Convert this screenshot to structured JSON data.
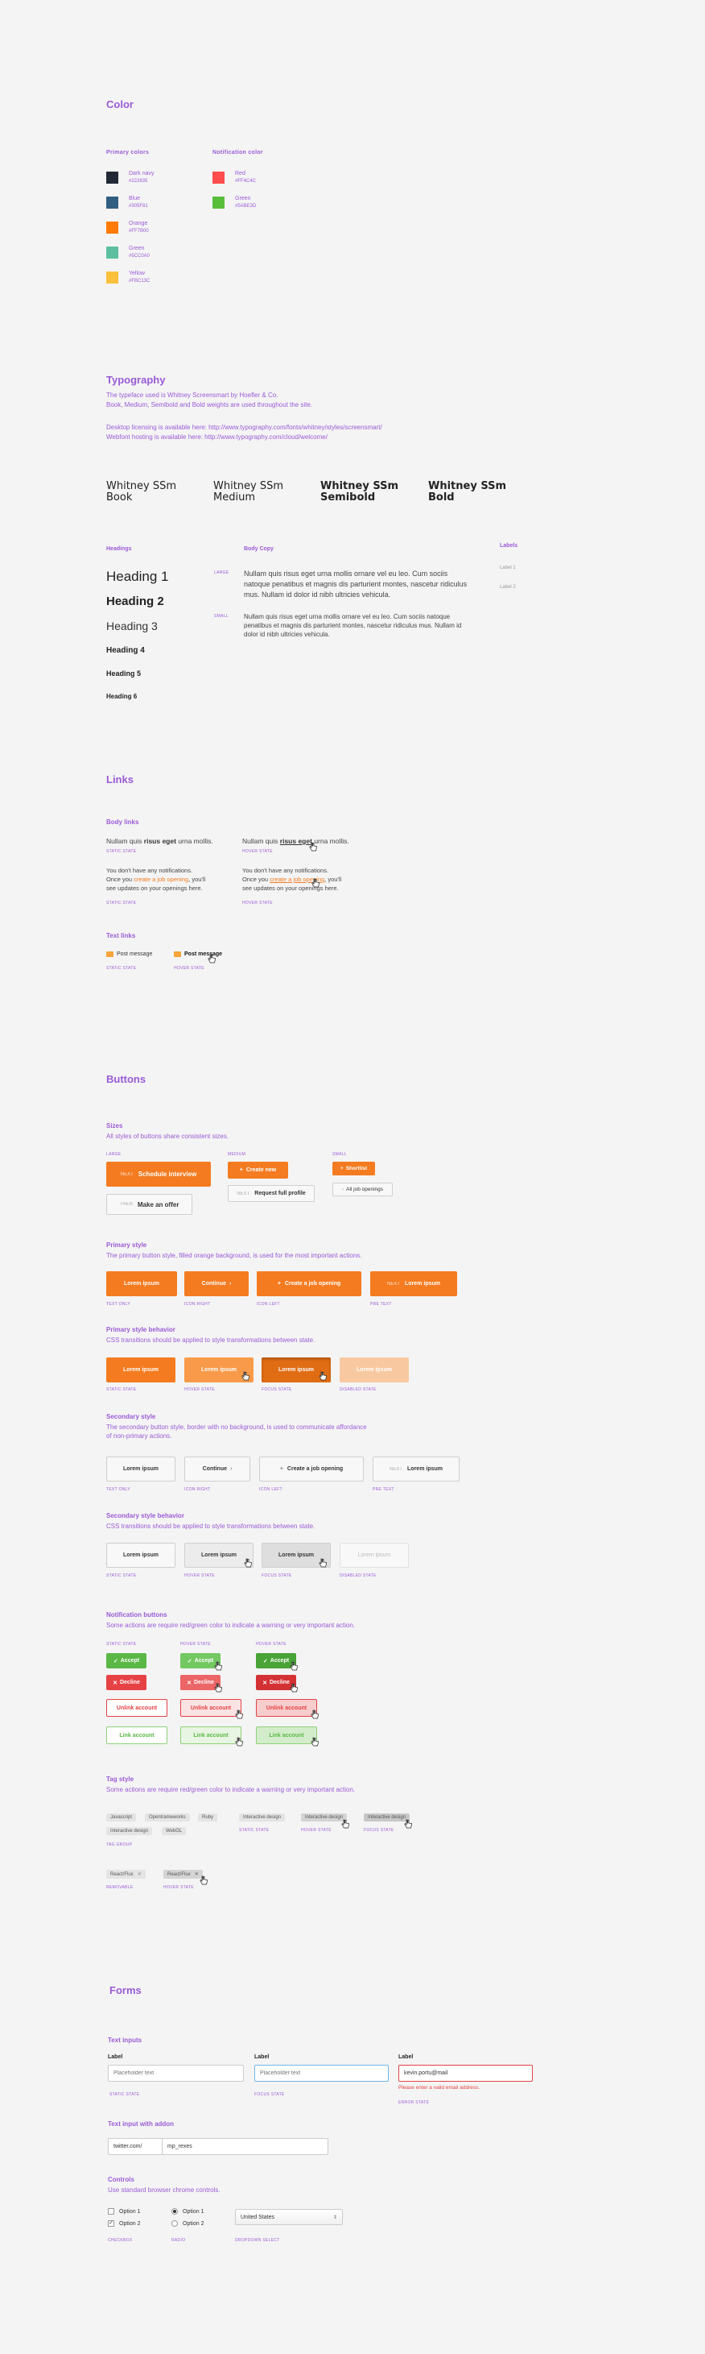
{
  "color": {
    "title": "Color",
    "primary_title": "Primary colors",
    "primary": [
      {
        "name": "Dark navy",
        "hex": "#222835",
        "color": "#222835"
      },
      {
        "name": "Blue",
        "hex": "#305F81",
        "color": "#305F81"
      },
      {
        "name": "Orange",
        "hex": "#FF7B00",
        "color": "#FF7B00"
      },
      {
        "name": "Green",
        "hex": "#5CC0A0",
        "color": "#5CC0A0"
      },
      {
        "name": "Yellow",
        "hex": "#FBC13C",
        "color": "#FBC13C"
      }
    ],
    "notif_title": "Notification color",
    "notif": [
      {
        "name": "Red",
        "hex": "#FF4C4C",
        "color": "#FF4C4C"
      },
      {
        "name": "Green",
        "hex": "#5ABE3D",
        "color": "#5ABE3D"
      }
    ]
  },
  "typography": {
    "title": "Typography",
    "line1": "The typeface used is Whitney Screensmart by Hoefler & Co.",
    "line2": "Book, Medium, Semibold and Bold weights are used throughout the site.",
    "line3": "Desktop licensing is available here: http://www.typography.com/fonts/whitney/styles/screensmart/",
    "line4": "Webfont hosting is available here: http://www.typography.com/cloud/welcome/",
    "weights": [
      "Whitney SSm Book",
      "Whitney SSm Medium",
      "Whitney SSm Semibold",
      "Whitney SSm Bold"
    ],
    "headings_label": "Headings",
    "headings": [
      "Heading 1",
      "Heading 2",
      "Heading 3",
      "Heading 4",
      "Heading 5",
      "Heading 6"
    ],
    "body_label": "Body Copy",
    "large_label": "LARGE",
    "small_label": "SMALL",
    "body_large": "Nullam quis risus eget urna mollis ornare vel eu leo. Cum sociis natoque penatibus et magnis dis parturient montes, nascetur ridiculus mus. Nullam id dolor id nibh ultricies vehicula.",
    "body_small": "Nullam quis risus eget urna mollis ornare vel eu leo. Cum sociis natoque penatibus et magnis dis parturient montes, nascetur ridiculus mus. Nullam id dolor id nibh ultricies vehicula.",
    "labels_label": "Labels",
    "label1": "Label 1",
    "label2": "Label 2"
  },
  "links": {
    "title": "Links",
    "body_title": "Body links",
    "link_pre": "Nullam quis",
    "link_word": "risus eget",
    "link_post": "urna mollis.",
    "static": "STATIC STATE",
    "hover": "HOVER STATE",
    "notif_1": "You don't have any notifications.",
    "notif_2a": "Once you",
    "notif_2b": "create a job opening",
    "notif_2c": ", you'll",
    "notif_3": "see updates on your openings here.",
    "text_title": "Text links",
    "post_message": "Post message"
  },
  "buttons": {
    "title": "Buttons",
    "sizes_title": "Sizes",
    "sizes_desc": "All styles of buttons share consistent sizes.",
    "large": "LARGE",
    "medium": "MEDIUM",
    "small": "SMALL",
    "next": "NEXT",
    "then": "THEN",
    "schedule": "Schedule interview",
    "make_offer": "Make an offer",
    "create_new": "Create new",
    "request": "Request full profile",
    "shortlist": "Shortlist",
    "all_jobs": "All job openings",
    "primary_title": "Primary style",
    "primary_desc": "The primary button style, filled orange background, is used for the most important actions.",
    "lorem": "Lorem ipsum",
    "continue": "Continue",
    "create_job": "Create a job opening",
    "text_only": "TEXT ONLY",
    "icon_right": "ICON RIGHT",
    "icon_left": "ICON LEFT",
    "pre_text": "PRE TEXT",
    "primary_beh_title": "Primary style behavior",
    "beh_desc": "CSS transitions should be applied to style transformations between state.",
    "static": "STATIC STATE",
    "hover": "HOVER STATE",
    "focus": "FOCUS STATE",
    "disabled": "DISABLED STATE",
    "secondary_title": "Secondary style",
    "secondary_desc1": "The secondary button style, border with no background, is used to communicate affordance",
    "secondary_desc2": "of non-primary actions.",
    "secondary_beh_title": "Secondary style behavior",
    "notif_title": "Notification buttons",
    "notif_desc": "Some actions are require red/green color to indicate a warning or very important action.",
    "accept": "Accept",
    "decline": "Decline",
    "unlink": "Unlink account",
    "link": "Link account",
    "tag_title": "Tag style",
    "tag_desc": "Some actions are require red/green color to indicate a warning or very important action.",
    "tags": [
      "Javascript",
      "Opentrameworks",
      "Ruby",
      "Interactive design",
      "WebGL"
    ],
    "tag_group": "TAG GROUP",
    "tag_single": "Interactive design",
    "removable_tag": "React/Flux",
    "removable": "REMOVABLE"
  },
  "forms": {
    "title": "Forms",
    "text_inputs_title": "Text inputs",
    "label": "Label",
    "placeholder": "Placeholder text",
    "error_value": "kevin.portu@mail",
    "error_msg": "Please enter a valid email address.",
    "static": "STATIC STATE",
    "focus": "FOCUS STATE",
    "error": "ERROR STATE",
    "addon_title": "Text input with addon",
    "addon": "twitter.com/",
    "addon_value": "mp_rexes",
    "controls_title": "Controls",
    "controls_desc": "Use standard browser chrome controls.",
    "option1": "Option 1",
    "option2": "Option 2",
    "checkbox": "CHECKBOX",
    "radio": "RADIO",
    "dropdown": "DROPDOWN SELECT",
    "select_value": "United States"
  }
}
